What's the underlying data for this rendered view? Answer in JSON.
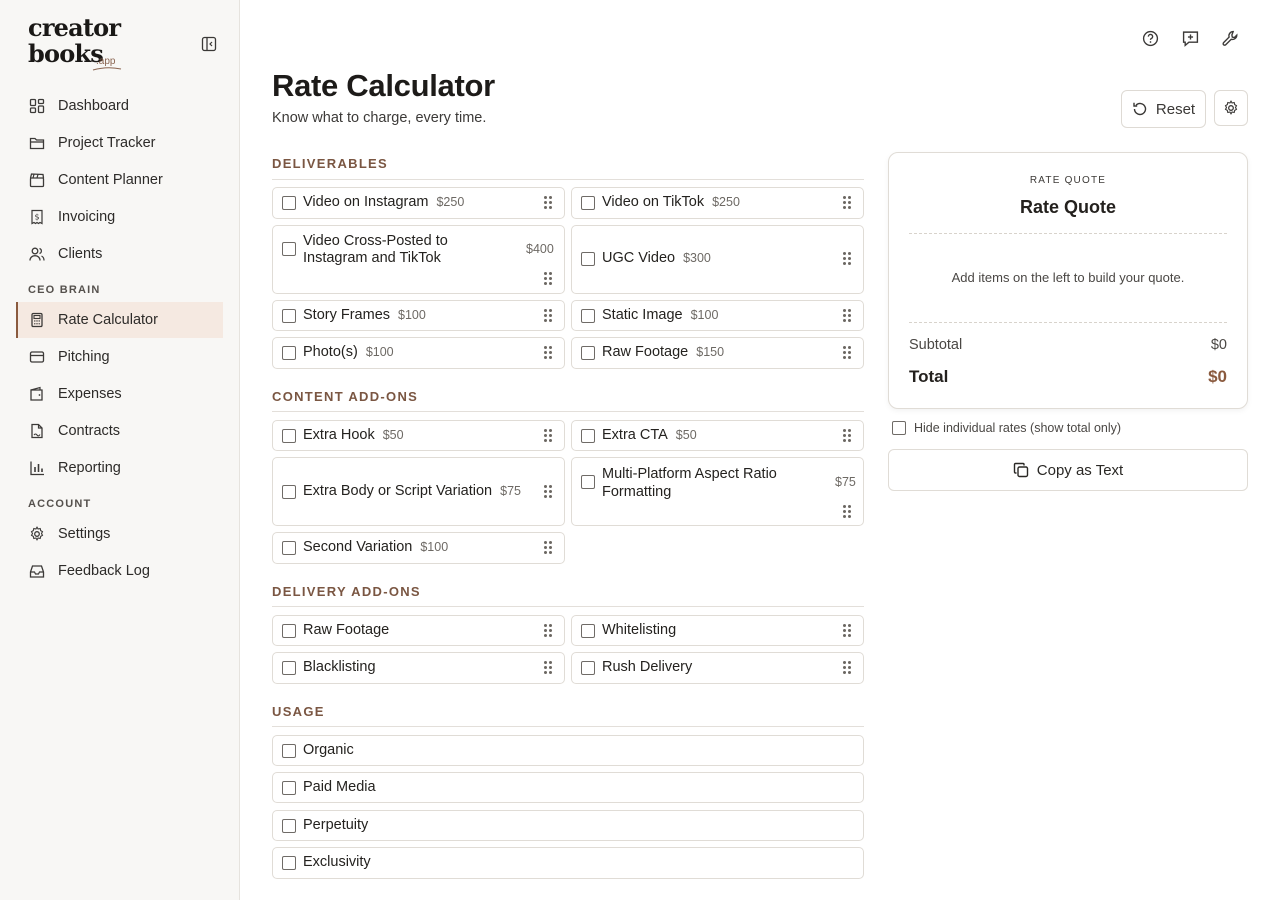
{
  "brand": {
    "line1": "creator",
    "line2": "books",
    "suffix": ".app"
  },
  "sidebar": {
    "main_items": [
      {
        "label": "Dashboard",
        "icon": "dashboard-icon"
      },
      {
        "label": "Project Tracker",
        "icon": "folder-icon"
      },
      {
        "label": "Content Planner",
        "icon": "clapperboard-icon"
      },
      {
        "label": "Invoicing",
        "icon": "receipt-dollar-icon"
      },
      {
        "label": "Clients",
        "icon": "users-icon"
      }
    ],
    "ceo_section": "CEO BRAIN",
    "ceo_items": [
      {
        "label": "Rate Calculator",
        "icon": "calculator-icon",
        "active": true
      },
      {
        "label": "Pitching",
        "icon": "cards-icon"
      },
      {
        "label": "Expenses",
        "icon": "wallet-icon"
      },
      {
        "label": "Contracts",
        "icon": "contract-icon"
      },
      {
        "label": "Reporting",
        "icon": "bar-chart-icon"
      }
    ],
    "account_section": "ACCOUNT",
    "account_items": [
      {
        "label": "Settings",
        "icon": "gear-icon"
      },
      {
        "label": "Feedback Log",
        "icon": "inbox-icon"
      }
    ]
  },
  "header": {
    "title": "Rate Calculator",
    "subtitle": "Know what to charge, every time.",
    "reset_label": "Reset",
    "top_icons": [
      "help-circle-icon",
      "message-plus-icon",
      "wrench-icon"
    ]
  },
  "sections": {
    "deliverables": {
      "title": "DELIVERABLES",
      "items": [
        {
          "label": "Video on Instagram",
          "price": "$250"
        },
        {
          "label": "Video on TikTok",
          "price": "$250"
        },
        {
          "label": "Video Cross-Posted to Instagram and TikTok",
          "price": "$400"
        },
        {
          "label": "UGC Video",
          "price": "$300"
        },
        {
          "label": "Story Frames",
          "price": "$100"
        },
        {
          "label": "Static Image",
          "price": "$100"
        },
        {
          "label": "Photo(s)",
          "price": "$100"
        },
        {
          "label": "Raw Footage",
          "price": "$150"
        }
      ]
    },
    "content_addons": {
      "title": "CONTENT ADD-ONS",
      "items": [
        {
          "label": "Extra Hook",
          "price": "$50"
        },
        {
          "label": "Extra CTA",
          "price": "$50"
        },
        {
          "label": "Extra Body or Script Variation",
          "price": "$75"
        },
        {
          "label": "Multi-Platform Aspect Ratio Formatting",
          "price": "$75"
        },
        {
          "label": "Second Variation",
          "price": "$100"
        }
      ]
    },
    "delivery_addons": {
      "title": "DELIVERY ADD-ONS",
      "items": [
        {
          "label": "Raw Footage"
        },
        {
          "label": "Whitelisting"
        },
        {
          "label": "Blacklisting"
        },
        {
          "label": "Rush Delivery"
        }
      ]
    },
    "usage": {
      "title": "USAGE",
      "items": [
        {
          "label": "Organic"
        },
        {
          "label": "Paid Media"
        },
        {
          "label": "Perpetuity"
        },
        {
          "label": "Exclusivity"
        }
      ]
    }
  },
  "quote": {
    "kicker": "RATE QUOTE",
    "title": "Rate Quote",
    "empty_text": "Add items on the left to build your quote.",
    "subtotal_label": "Subtotal",
    "subtotal_value": "$0",
    "total_label": "Total",
    "total_value": "$0",
    "hide_rates_label": "Hide individual rates (show total only)",
    "copy_label": "Copy as Text"
  },
  "colors": {
    "accent": "#8a5a3e",
    "active_bg": "#f5e9e1",
    "section_title": "#7a5642"
  }
}
